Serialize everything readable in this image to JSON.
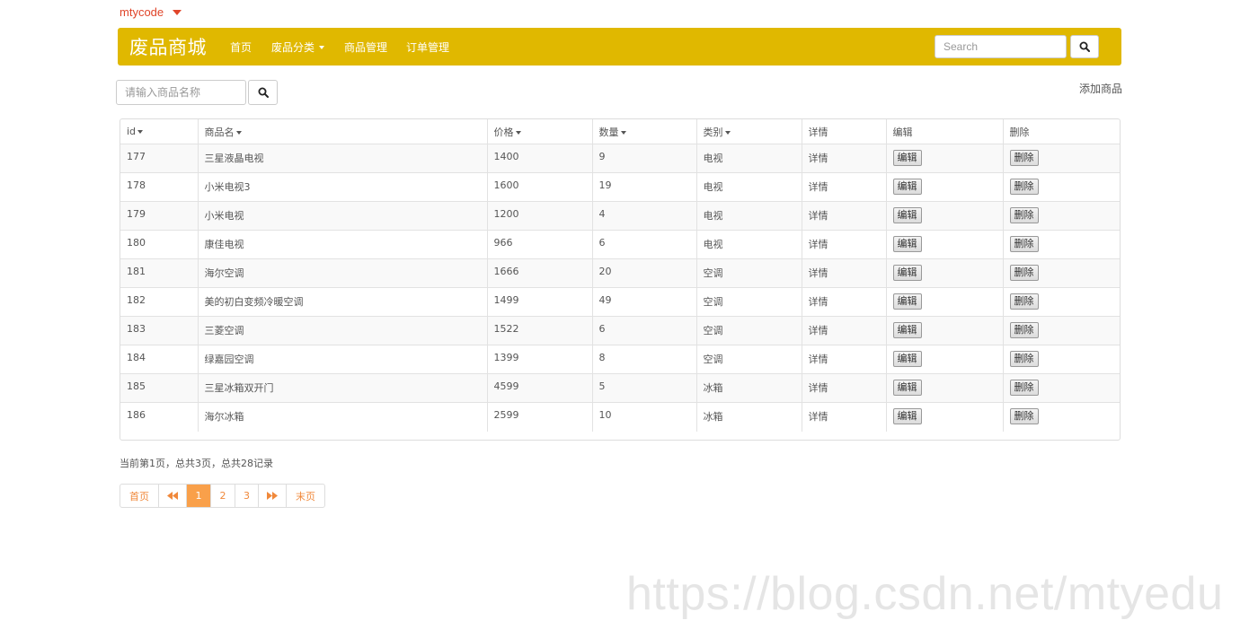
{
  "user": {
    "name": "mtycode"
  },
  "navbar": {
    "brand": "废品商城",
    "items": [
      {
        "label": "首页"
      },
      {
        "label": "废品分类",
        "has_dropdown": true
      },
      {
        "label": "商品管理"
      },
      {
        "label": "订单管理"
      }
    ],
    "search_placeholder": "Search"
  },
  "toolbar": {
    "search_placeholder": "请输入商品名称",
    "add_label": "添加商品"
  },
  "table": {
    "headers": [
      "id",
      "商品名",
      "价格",
      "数量",
      "类别",
      "详情",
      "编辑",
      "删除"
    ],
    "sortable": [
      true,
      true,
      true,
      true,
      true,
      false,
      false,
      false
    ],
    "rows": [
      {
        "id": "177",
        "name": "三星液晶电视",
        "price": "1400",
        "qty": "9",
        "category": "电视",
        "detail": "详情",
        "edit": "编辑",
        "delete": "删除"
      },
      {
        "id": "178",
        "name": "小米电视3",
        "price": "1600",
        "qty": "19",
        "category": "电视",
        "detail": "详情",
        "edit": "编辑",
        "delete": "删除"
      },
      {
        "id": "179",
        "name": "小米电视",
        "price": "1200",
        "qty": "4",
        "category": "电视",
        "detail": "详情",
        "edit": "编辑",
        "delete": "删除"
      },
      {
        "id": "180",
        "name": "康佳电视",
        "price": "966",
        "qty": "6",
        "category": "电视",
        "detail": "详情",
        "edit": "编辑",
        "delete": "删除"
      },
      {
        "id": "181",
        "name": "海尔空调",
        "price": "1666",
        "qty": "20",
        "category": "空调",
        "detail": "详情",
        "edit": "编辑",
        "delete": "删除"
      },
      {
        "id": "182",
        "name": "美的初白变频冷暖空调",
        "price": "1499",
        "qty": "49",
        "category": "空调",
        "detail": "详情",
        "edit": "编辑",
        "delete": "删除"
      },
      {
        "id": "183",
        "name": "三菱空调",
        "price": "1522",
        "qty": "6",
        "category": "空调",
        "detail": "详情",
        "edit": "编辑",
        "delete": "删除"
      },
      {
        "id": "184",
        "name": "绿嘉园空调",
        "price": "1399",
        "qty": "8",
        "category": "空调",
        "detail": "详情",
        "edit": "编辑",
        "delete": "删除"
      },
      {
        "id": "185",
        "name": "三星冰箱双开门",
        "price": "4599",
        "qty": "5",
        "category": "冰箱",
        "detail": "详情",
        "edit": "编辑",
        "delete": "删除"
      },
      {
        "id": "186",
        "name": "海尔冰箱",
        "price": "2599",
        "qty": "10",
        "category": "冰箱",
        "detail": "详情",
        "edit": "编辑",
        "delete": "删除"
      }
    ]
  },
  "pagination": {
    "info": "当前第1页，总共3页，总共28记录",
    "first": "首页",
    "prev": "◀◀",
    "pages": [
      "1",
      "2",
      "3"
    ],
    "current": "1",
    "next": "▶▶",
    "last": "末页"
  },
  "watermark": "https://blog.csdn.net/mtyedu",
  "colors": {
    "navbar": "#e0b800",
    "accent": "#f9a04a",
    "user_link": "#e0452a"
  }
}
